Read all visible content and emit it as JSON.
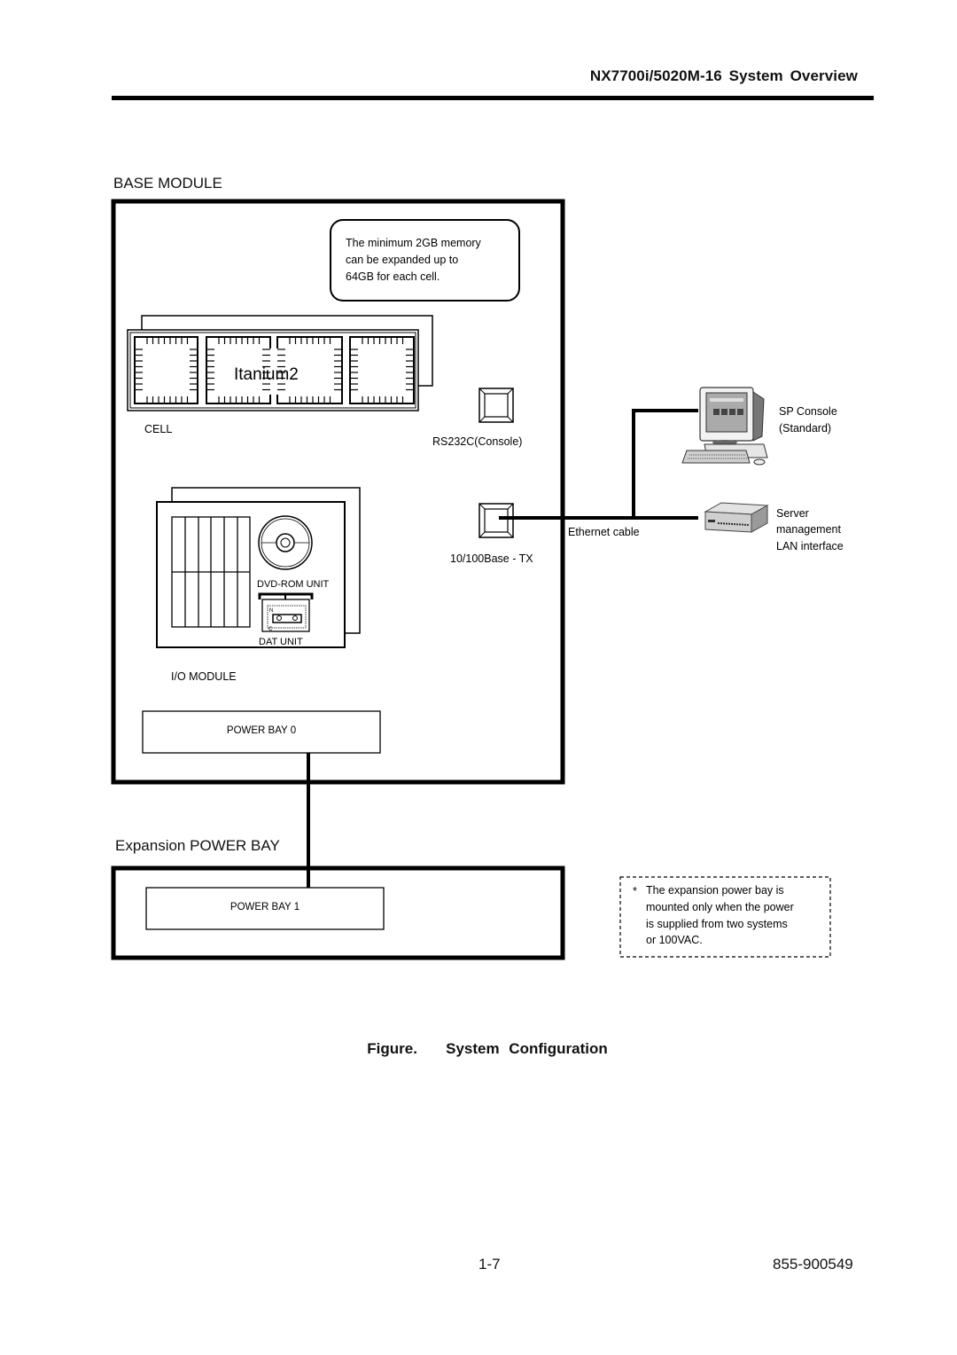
{
  "header": {
    "title": "NX7700i/5020M-16 System Overview"
  },
  "figure": {
    "base_module": {
      "label": "BASE MODULE",
      "memory_note": {
        "lines": [
          "The minimum 2GB memory",
          "can be expanded up to",
          "64GB for each cell."
        ]
      },
      "cell": {
        "label": "CELL",
        "cpu_label": "Itanium2"
      },
      "io_module": {
        "label": "I/O MODULE",
        "dvd_label": "DVD-ROM UNIT",
        "dat_label": "DAT UNIT",
        "dat_tape_letters": [
          "N",
          "C"
        ]
      },
      "ports": {
        "rs232c_label": "RS232C(Console)",
        "ethernet_port_label": "10/100Base - TX"
      },
      "power_bay_0": "POWER BAY 0"
    },
    "expansion": {
      "label": "Expansion POWER BAY",
      "power_bay_1": "POWER BAY 1",
      "note": {
        "bullet": "*",
        "lines": [
          "The expansion power bay is",
          "mounted only when the power",
          "is supplied from two systems",
          "or 100VAC."
        ]
      }
    },
    "network": {
      "cable_label": "Ethernet cable",
      "sp_console": {
        "lines": [
          "SP Console",
          "(Standard)"
        ],
        "icon": "desktop-computer-icon"
      },
      "server_mgmt": {
        "lines": [
          "Server",
          "management",
          "LAN interface"
        ],
        "icon": "network-hub-icon"
      }
    },
    "caption": "Figure.   System Configuration"
  },
  "footer": {
    "page_number": "1-7",
    "document_number": "855-900549"
  }
}
